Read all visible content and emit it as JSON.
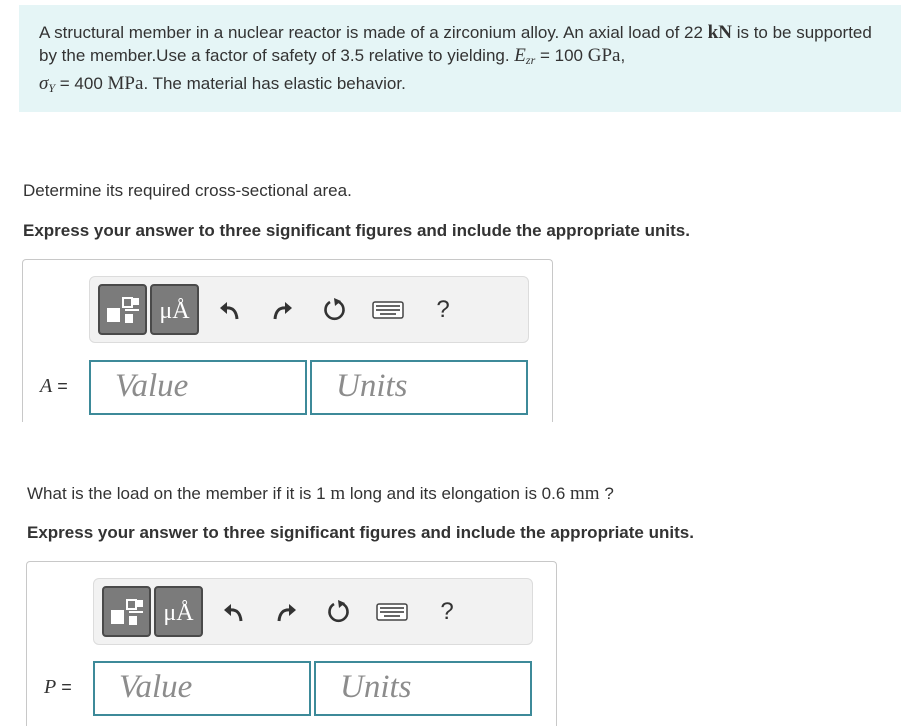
{
  "problem": {
    "seg1": "A structural member in a nuclear reactor is made of a zirconium alloy. An axial load of 22 ",
    "load_unit": "kN",
    "seg2": " is to be supported by the member.Use a factor of safety of 3.5 relative to yielding. ",
    "E_symbol": "E",
    "E_sub": "zr",
    "E_value": " = 100 ",
    "E_unit": "GPa",
    "comma": ",",
    "sigma_symbol": "σ",
    "sigma_sub": "Y",
    "sigma_value": " = 400 ",
    "sigma_unit": "MPa",
    "seg3": ". The material has elastic behavior."
  },
  "part1": {
    "question": "Determine its required cross-sectional area.",
    "instruction": "Express your answer to three significant figures and include the appropriate units.",
    "variable": "A",
    "equals": " =",
    "value_placeholder": "Value",
    "units_placeholder": "Units"
  },
  "part2": {
    "q_seg1": "What is the load on the member if it is 1 ",
    "length_unit": "m",
    "q_seg2": " long and its elongation is 0.6 ",
    "elong_unit": "mm",
    "q_seg3": " ?",
    "instruction": "Express your answer to three significant figures and include the appropriate units.",
    "variable": "P",
    "equals": " =",
    "value_placeholder": "Value",
    "units_placeholder": "Units"
  },
  "toolbar": {
    "units_glyph": "μÅ",
    "help": "?",
    "icons": [
      "templates-icon",
      "units-icon",
      "undo-icon",
      "redo-icon",
      "reset-icon",
      "keyboard-icon",
      "help-icon"
    ]
  },
  "colors": {
    "problem_bg": "#e5f5f6",
    "field_border": "#3d8a99",
    "tool_button": "#7b7b7b"
  }
}
